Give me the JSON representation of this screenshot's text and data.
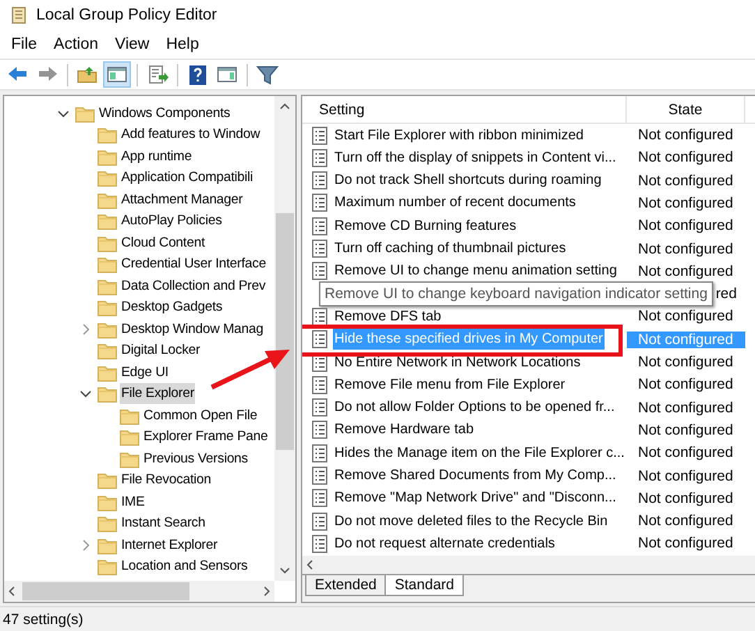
{
  "window": {
    "title": "Local Group Policy Editor"
  },
  "menu": [
    "File",
    "Action",
    "View",
    "Help"
  ],
  "toolbar": [
    {
      "kind": "back",
      "disabled": false,
      "selected": false
    },
    {
      "kind": "forward",
      "disabled": true,
      "selected": false
    },
    {
      "kind": "up",
      "disabled": false,
      "selected": false
    },
    {
      "kind": "tree-toggle",
      "disabled": false,
      "selected": true
    },
    {
      "kind": "export",
      "disabled": false,
      "selected": false
    },
    {
      "kind": "help",
      "disabled": false,
      "selected": false
    },
    {
      "kind": "pane",
      "disabled": false,
      "selected": false
    },
    {
      "kind": "filter",
      "disabled": false,
      "selected": false
    }
  ],
  "tree": [
    {
      "label": "Windows Components",
      "expanded": true,
      "selected": false,
      "children": [
        {
          "label": "Add features to Window",
          "selected": false
        },
        {
          "label": "App runtime",
          "selected": false
        },
        {
          "label": "Application Compatibili",
          "selected": false
        },
        {
          "label": "Attachment Manager",
          "selected": false
        },
        {
          "label": "AutoPlay Policies",
          "selected": false
        },
        {
          "label": "Cloud Content",
          "selected": false
        },
        {
          "label": "Credential User Interface",
          "selected": false
        },
        {
          "label": "Data Collection and Prev",
          "selected": false
        },
        {
          "label": "Desktop Gadgets",
          "selected": false
        },
        {
          "label": "Desktop Window Manag",
          "expanded": false,
          "selected": false
        },
        {
          "label": "Digital Locker",
          "selected": false
        },
        {
          "label": "Edge UI",
          "selected": false
        },
        {
          "label": "File Explorer",
          "expanded": true,
          "selected": true,
          "children": [
            {
              "label": "Common Open File",
              "selected": false
            },
            {
              "label": "Explorer Frame Pane",
              "selected": false
            },
            {
              "label": "Previous Versions",
              "selected": false
            }
          ]
        },
        {
          "label": "File Revocation",
          "selected": false
        },
        {
          "label": "IME",
          "selected": false
        },
        {
          "label": "Instant Search",
          "selected": false
        },
        {
          "label": "Internet Explorer",
          "expanded": false,
          "selected": false
        },
        {
          "label": "Location and Sensors",
          "selected": false
        }
      ]
    }
  ],
  "table": {
    "columns": [
      "Setting",
      "State"
    ],
    "rows": [
      {
        "kind": "setting",
        "setting": "Start File Explorer with ribbon minimized",
        "state": "Not configured",
        "selected": false
      },
      {
        "kind": "setting",
        "setting": "Turn off the display of snippets in Content vi...",
        "state": "Not configured",
        "selected": false
      },
      {
        "kind": "setting",
        "setting": "Do not track Shell shortcuts during roaming",
        "state": "Not configured",
        "selected": false
      },
      {
        "kind": "setting",
        "setting": "Maximum number of recent documents",
        "state": "Not configured",
        "selected": false
      },
      {
        "kind": "setting",
        "setting": "Remove CD Burning features",
        "state": "Not configured",
        "selected": false
      },
      {
        "kind": "setting",
        "setting": "Turn off caching of thumbnail pictures",
        "state": "Not configured",
        "selected": false
      },
      {
        "kind": "setting",
        "setting": "Remove UI to change menu animation setting",
        "state": "Not configured",
        "selected": false
      },
      {
        "kind": "covered",
        "tooltip": "Remove UI to change keyboard navigation indicator setting",
        "state": "red",
        "selected": false
      },
      {
        "kind": "setting",
        "setting": "Remove DFS tab",
        "state": "Not configured",
        "selected": false
      },
      {
        "kind": "setting",
        "setting": "Hide these specified drives in My Computer",
        "state": "Not configured",
        "selected": true,
        "highlighted": true
      },
      {
        "kind": "setting",
        "setting": "No Entire Network in Network Locations",
        "state": "Not configured",
        "selected": false
      },
      {
        "kind": "setting",
        "setting": "Remove File menu from File Explorer",
        "state": "Not configured",
        "selected": false
      },
      {
        "kind": "setting",
        "setting": "Do not allow Folder Options to be opened fr...",
        "state": "Not configured",
        "selected": false
      },
      {
        "kind": "setting",
        "setting": "Remove Hardware tab",
        "state": "Not configured",
        "selected": false
      },
      {
        "kind": "setting",
        "setting": "Hides the Manage item on the File Explorer c...",
        "state": "Not configured",
        "selected": false
      },
      {
        "kind": "setting",
        "setting": "Remove Shared Documents from My Comp...",
        "state": "Not configured",
        "selected": false
      },
      {
        "kind": "setting",
        "setting": "Remove \"Map Network Drive\" and \"Disconn...",
        "state": "Not configured",
        "selected": false
      },
      {
        "kind": "setting",
        "setting": "Do not move deleted files to the Recycle Bin",
        "state": "Not configured",
        "selected": false
      },
      {
        "kind": "setting",
        "setting": "Do not request alternate credentials",
        "state": "Not configured",
        "selected": false
      }
    ]
  },
  "tabs": [
    {
      "label": "Extended",
      "selected": false
    },
    {
      "label": "Standard",
      "selected": true
    }
  ],
  "annotation": {
    "kind": "arrow"
  },
  "status_bar": "47 setting(s)"
}
